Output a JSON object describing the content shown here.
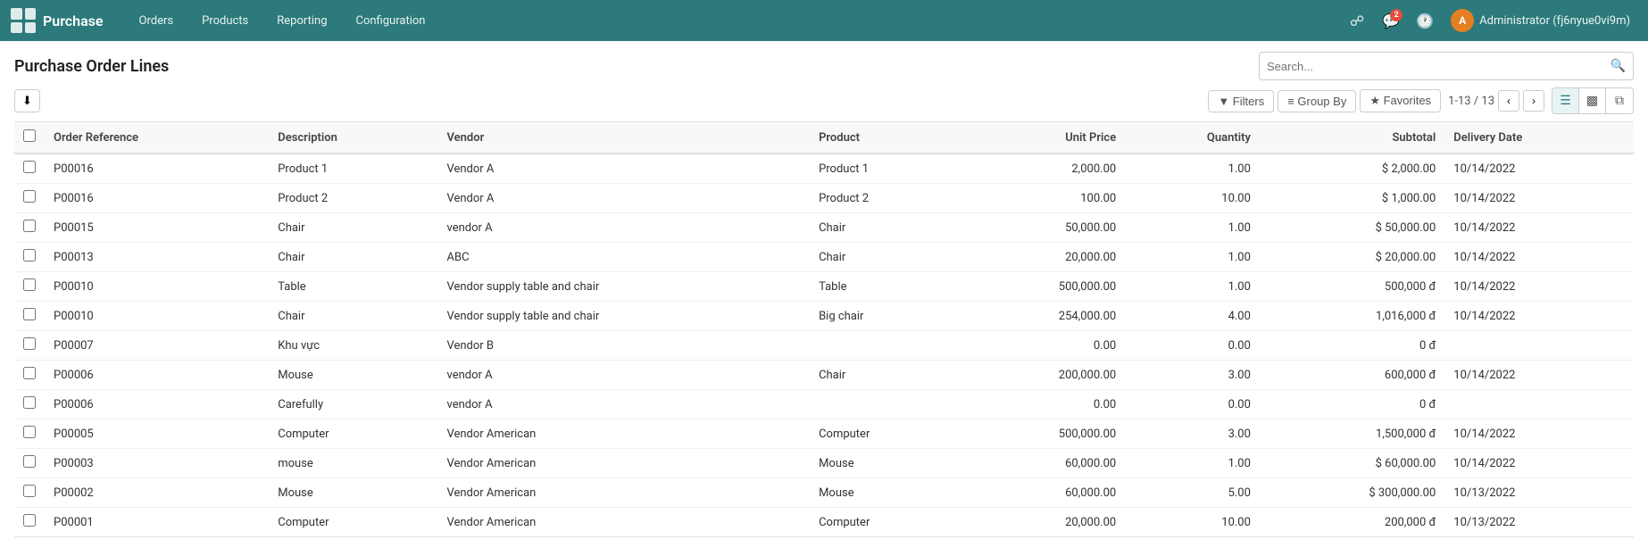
{
  "app": {
    "name": "Purchase",
    "logo_alt": "grid-icon"
  },
  "nav": {
    "links": [
      "Orders",
      "Products",
      "Reporting",
      "Configuration"
    ]
  },
  "topbar_right": {
    "notification_count": "2",
    "user_initial": "A",
    "user_name": "Administrator (fj6nyue0vi9m)"
  },
  "page": {
    "title": "Purchase Order Lines"
  },
  "search": {
    "placeholder": "Search..."
  },
  "toolbar": {
    "export_label": "⬇",
    "filters_label": "▼ Filters",
    "group_by_label": "≡ Group By",
    "favorites_label": "★ Favorites",
    "pagination": "1-13 / 13"
  },
  "columns": {
    "headers": [
      "Order Reference",
      "Description",
      "Vendor",
      "Product",
      "Unit Price",
      "Quantity",
      "Subtotal",
      "Delivery Date"
    ]
  },
  "rows": [
    {
      "ref": "P00016",
      "desc": "Product 1",
      "vendor": "Vendor A",
      "product": "Product 1",
      "unit_price": "2,000.00",
      "quantity": "1.00",
      "subtotal": "$ 2,000.00",
      "delivery": "10/14/2022"
    },
    {
      "ref": "P00016",
      "desc": "Product 2",
      "vendor": "Vendor A",
      "product": "Product 2",
      "unit_price": "100.00",
      "quantity": "10.00",
      "subtotal": "$ 1,000.00",
      "delivery": "10/14/2022"
    },
    {
      "ref": "P00015",
      "desc": "Chair",
      "vendor": "vendor A",
      "product": "Chair",
      "unit_price": "50,000.00",
      "quantity": "1.00",
      "subtotal": "$ 50,000.00",
      "delivery": "10/14/2022"
    },
    {
      "ref": "P00013",
      "desc": "Chair",
      "vendor": "ABC",
      "product": "Chair",
      "unit_price": "20,000.00",
      "quantity": "1.00",
      "subtotal": "$ 20,000.00",
      "delivery": "10/14/2022"
    },
    {
      "ref": "P00010",
      "desc": "Table",
      "vendor": "Vendor supply table and chair",
      "product": "Table",
      "unit_price": "500,000.00",
      "quantity": "1.00",
      "subtotal": "500,000 đ",
      "delivery": "10/14/2022"
    },
    {
      "ref": "P00010",
      "desc": "Chair",
      "vendor": "Vendor supply table and chair",
      "product": "Big chair",
      "unit_price": "254,000.00",
      "quantity": "4.00",
      "subtotal": "1,016,000 đ",
      "delivery": "10/14/2022"
    },
    {
      "ref": "P00007",
      "desc": "Khu vực",
      "vendor": "Vendor B",
      "product": "",
      "unit_price": "0.00",
      "quantity": "0.00",
      "subtotal": "0 đ",
      "delivery": ""
    },
    {
      "ref": "P00006",
      "desc": "Mouse",
      "vendor": "vendor A",
      "product": "Chair",
      "unit_price": "200,000.00",
      "quantity": "3.00",
      "subtotal": "600,000 đ",
      "delivery": "10/14/2022"
    },
    {
      "ref": "P00006",
      "desc": "Carefully",
      "vendor": "vendor A",
      "product": "",
      "unit_price": "0.00",
      "quantity": "0.00",
      "subtotal": "0 đ",
      "delivery": ""
    },
    {
      "ref": "P00005",
      "desc": "Computer",
      "vendor": "Vendor American",
      "product": "Computer",
      "unit_price": "500,000.00",
      "quantity": "3.00",
      "subtotal": "1,500,000 đ",
      "delivery": "10/14/2022"
    },
    {
      "ref": "P00003",
      "desc": "mouse",
      "vendor": "Vendor American",
      "product": "Mouse",
      "unit_price": "60,000.00",
      "quantity": "1.00",
      "subtotal": "$ 60,000.00",
      "delivery": "10/14/2022"
    },
    {
      "ref": "P00002",
      "desc": "Mouse",
      "vendor": "Vendor American",
      "product": "Mouse",
      "unit_price": "60,000.00",
      "quantity": "5.00",
      "subtotal": "$ 300,000.00",
      "delivery": "10/13/2022"
    },
    {
      "ref": "P00001",
      "desc": "Computer",
      "vendor": "Vendor American",
      "product": "Computer",
      "unit_price": "20,000.00",
      "quantity": "10.00",
      "subtotal": "200,000 đ",
      "delivery": "10/13/2022"
    }
  ]
}
